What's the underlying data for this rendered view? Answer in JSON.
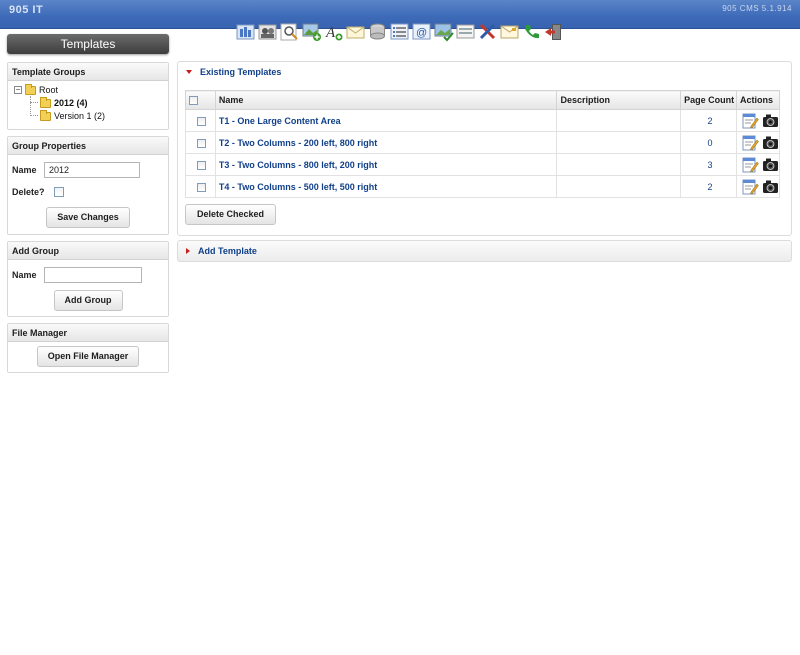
{
  "app": {
    "brand": "905 IT",
    "version": "905 CMS 5.1.914"
  },
  "toolbar": {
    "icons": [
      "sitemap-icon",
      "users-icon",
      "search-icon",
      "image-add-icon",
      "text-add-icon",
      "mail-icon",
      "database-icon",
      "list-icon",
      "email-icon",
      "image-check-icon",
      "form-icon",
      "tools-icon",
      "envelope-icon",
      "phone-icon",
      "logout-icon"
    ]
  },
  "sidebar": {
    "title": "Templates",
    "template_groups": {
      "header": "Template Groups",
      "root_label": "Root",
      "items": [
        {
          "label": "2012 (4)"
        },
        {
          "label": "Version 1 (2)"
        }
      ]
    },
    "group_properties": {
      "header": "Group Properties",
      "name_label": "Name",
      "name_value": "2012",
      "delete_label": "Delete?",
      "save_button": "Save Changes"
    },
    "add_group": {
      "header": "Add Group",
      "name_label": "Name",
      "name_value": "",
      "button": "Add Group"
    },
    "file_manager": {
      "header": "File Manager",
      "button": "Open File Manager"
    }
  },
  "main": {
    "existing": {
      "header": "Existing Templates",
      "columns": [
        "Name",
        "Description",
        "Page Count",
        "Actions"
      ],
      "rows": [
        {
          "name": "T1 - One Large Content Area",
          "description": "",
          "page_count": "2"
        },
        {
          "name": "T2 - Two Columns - 200 left, 800 right",
          "description": "",
          "page_count": "0"
        },
        {
          "name": "T3 - Two Columns - 800 left, 200 right",
          "description": "",
          "page_count": "3"
        },
        {
          "name": "T4 - Two Columns - 500 left, 500 right",
          "description": "",
          "page_count": "2"
        }
      ],
      "delete_button": "Delete Checked"
    },
    "add_template": {
      "header": "Add Template"
    }
  }
}
